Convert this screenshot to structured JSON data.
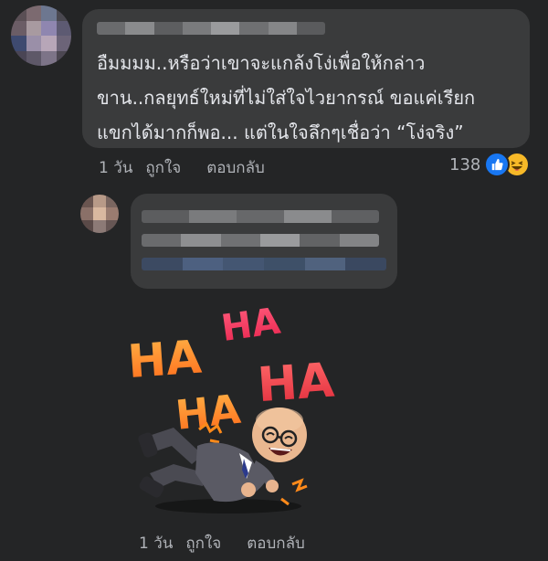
{
  "comment1": {
    "text_lines": [
      "อืมมมม..หรือว่าเขาจะแกล้งโง่เพื่อให้กล่าว",
      "ขาน..กลยุทธ์ใหม่ที่ไม่ใส่ใจไวยากรณ์ ขอแค่เรียก",
      "แขกได้มากก็พอ... แต่ในใจลึกๆเชื่อว่า “โง่จริง”"
    ],
    "time": "1 วัน",
    "like_label": "ถูกใจ",
    "reply_label": "ตอบกลับ",
    "reaction_count": "138",
    "reaction_icons": [
      "like-icon",
      "haha-icon"
    ]
  },
  "comment2": {
    "sticker_words": [
      "HA",
      "HA",
      "HA",
      "HA"
    ],
    "time": "1 วัน",
    "like_label": "ถูกใจ",
    "reply_label": "ตอบกลับ"
  },
  "colors": {
    "background": "#242526",
    "bubble": "#3a3b3c",
    "text": "#e4e6eb",
    "meta": "#b0b3b8",
    "like_blue": "#1877f2",
    "haha_yellow": "#f7b928"
  }
}
